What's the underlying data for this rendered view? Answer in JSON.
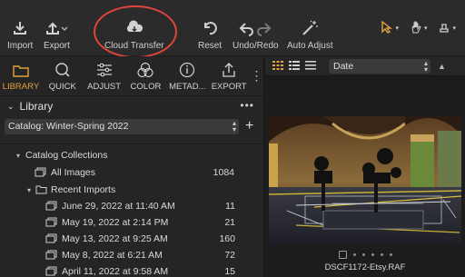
{
  "toolbar": {
    "import_label": "Import",
    "export_label": "Export",
    "cloud_label": "Cloud Transfer",
    "reset_label": "Reset",
    "undoredo_label": "Undo/Redo",
    "autoadjust_label": "Auto Adjust",
    "annotation_color": "#e0443a"
  },
  "tabs": [
    {
      "label": "LIBRARY",
      "icon": "folder-icon"
    },
    {
      "label": "QUICK",
      "icon": "magnifier-icon"
    },
    {
      "label": "ADJUST",
      "icon": "sliders-icon"
    },
    {
      "label": "COLOR",
      "icon": "color-circles-icon"
    },
    {
      "label": "METAD...",
      "icon": "info-icon"
    },
    {
      "label": "EXPORT",
      "icon": "share-icon"
    }
  ],
  "accent_color": "#e2a33a",
  "library": {
    "title": "Library",
    "catalog": "Catalog: Winter-Spring 2022",
    "collections_title": "Catalog Collections",
    "all_images": {
      "label": "All Images",
      "count": "1084"
    },
    "recent_imports": {
      "label": "Recent Imports",
      "items": [
        {
          "label": "June 29, 2022 at 11:40 AM",
          "count": "11"
        },
        {
          "label": "May 19, 2022 at 2:14 PM",
          "count": "21"
        },
        {
          "label": "May 13, 2022 at 9:25 AM",
          "count": "160"
        },
        {
          "label": "May 8, 2022 at 6:21 AM",
          "count": "72"
        },
        {
          "label": "April 11, 2022 at 9:58 AM",
          "count": "15"
        }
      ]
    }
  },
  "browser": {
    "sort_value": "Date",
    "filename": "DSCF1172-Etsy.RAF"
  }
}
